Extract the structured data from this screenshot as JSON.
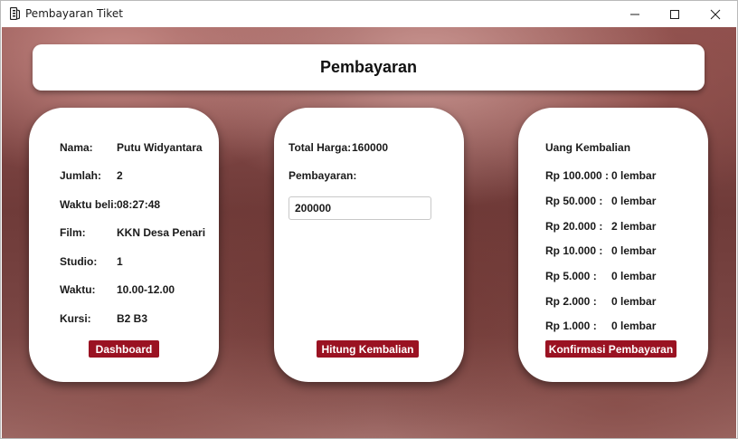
{
  "window": {
    "title": "Pembayaran Tiket"
  },
  "header": {
    "title": "Pembayaran"
  },
  "info": {
    "rows": [
      {
        "label": "Nama:",
        "value": "Putu Widyantara"
      },
      {
        "label": "Jumlah:",
        "value": "2"
      },
      {
        "label": "Waktu beli:",
        "value": "08:27:48"
      },
      {
        "label": "Film:",
        "value": "KKN Desa Penari"
      },
      {
        "label": "Studio:",
        "value": "1"
      },
      {
        "label": "Waktu:",
        "value": "10.00-12.00"
      },
      {
        "label": "Kursi:",
        "value": "B2 B3"
      }
    ],
    "dashboard_label": "Dashboard"
  },
  "payment": {
    "total_label": "Total Harga:",
    "total_value": "160000",
    "payment_label": "Pembayaran:",
    "payment_value": "200000",
    "calc_label": "Hitung Kembalian"
  },
  "change": {
    "title": "Uang Kembalian",
    "rows": [
      {
        "denom": "Rp 100.000 :",
        "count": "0 lembar"
      },
      {
        "denom": "Rp 50.000 :",
        "count": "0 lembar"
      },
      {
        "denom": "Rp 20.000 :",
        "count": "2 lembar"
      },
      {
        "denom": "Rp 10.000 :",
        "count": "0 lembar"
      },
      {
        "denom": "Rp 5.000 :",
        "count": "0 lembar"
      },
      {
        "denom": "Rp 2.000 :",
        "count": "0 lembar"
      },
      {
        "denom": "Rp 1.000 :",
        "count": "0 lembar"
      }
    ],
    "confirm_label": "Konfirmasi Pembayaran"
  },
  "colors": {
    "accent": "#9a1222",
    "card": "#ffffff"
  },
  "icons": [
    "app-icon",
    "minimize-icon",
    "maximize-icon",
    "close-icon"
  ]
}
